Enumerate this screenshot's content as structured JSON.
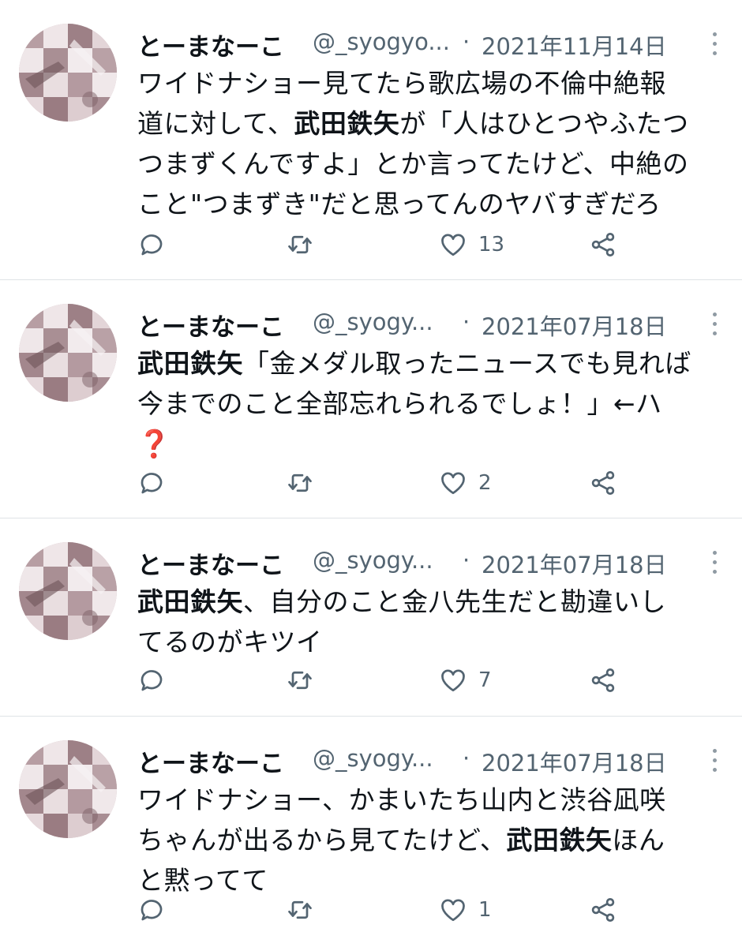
{
  "tweets": [
    {
      "name": "とーまなーこ",
      "handle": "@_syogyo...",
      "separator": "·",
      "date": "2021年11月14日",
      "lines": [
        [
          {
            "t": "ワイドナショー見てたら歌広場の不倫中絶報"
          }
        ],
        [
          {
            "t": "道に対して、"
          },
          {
            "t": "武田鉄矢",
            "b": true
          },
          {
            "t": "が「人はひとつやふたつ"
          }
        ],
        [
          {
            "t": "つまずくんですよ」とか言ってたけど、中絶の"
          }
        ],
        [
          {
            "t": "こと\"つまずき\"だと思ってんのヤバすぎだろ"
          }
        ]
      ],
      "reply_count": "",
      "retweet_count": "",
      "like_count": "13"
    },
    {
      "name": "とーまなーこ",
      "handle": "@_syogy...",
      "separator": "·",
      "date": "2021年07月18日",
      "lines": [
        [
          {
            "t": "武田鉄矢",
            "b": true
          },
          {
            "t": "「金メダル取ったニュースでも見れば"
          }
        ],
        [
          {
            "t": "今までのこと全部忘れられるでしょ！」←ハ"
          }
        ],
        [
          {
            "t": "❓",
            "q": true
          }
        ]
      ],
      "reply_count": "",
      "retweet_count": "",
      "like_count": "2"
    },
    {
      "name": "とーまなーこ",
      "handle": "@_syogy...",
      "separator": "·",
      "date": "2021年07月18日",
      "lines": [
        [
          {
            "t": "武田鉄矢",
            "b": true
          },
          {
            "t": "、自分のこと金八先生だと勘違いし"
          }
        ],
        [
          {
            "t": "てるのがキツイ"
          }
        ]
      ],
      "reply_count": "",
      "retweet_count": "",
      "like_count": "7"
    },
    {
      "name": "とーまなーこ",
      "handle": "@_syogy...",
      "separator": "·",
      "date": "2021年07月18日",
      "lines": [
        [
          {
            "t": "ワイドナショー、かまいたち山内と渋谷凪咲"
          }
        ],
        [
          {
            "t": "ちゃんが出るから見てたけど、"
          },
          {
            "t": "武田鉄矢",
            "b": true
          },
          {
            "t": "ほん"
          }
        ],
        [
          {
            "t": "と黙ってて"
          }
        ]
      ],
      "reply_count": "",
      "retweet_count": "",
      "like_count": "1"
    }
  ],
  "icons": {
    "reply": "reply-icon",
    "retweet": "retweet-icon",
    "like": "heart-icon",
    "share": "share-icon",
    "more": "more-dots-icon"
  },
  "colors": {
    "text": "#0f1419",
    "muted": "#536471",
    "divider": "#dfe3e6",
    "question_mark": "#c8102e"
  }
}
